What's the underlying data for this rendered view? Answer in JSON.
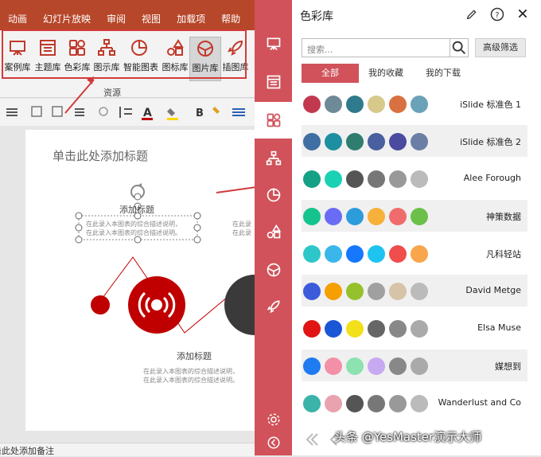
{
  "ribbon": {
    "tabs": [
      "动画",
      "幻灯片放映",
      "审阅",
      "视图",
      "加载项",
      "帮助",
      "O"
    ],
    "buttons": [
      "案例库",
      "主题库",
      "色彩库",
      "图示库",
      "智能图表",
      "图标库",
      "图片库",
      "插图库"
    ],
    "group_label": "资源"
  },
  "slide": {
    "title_placeholder": "单击此处添加标题",
    "node_title_1": "添加标题",
    "node_title_2": "添加标题",
    "desc_line_1": "在此录入本图表的综合描述说明，",
    "desc_line_2": "在此录入本图表的综合描述说明。",
    "desc_right_1": "在此录",
    "desc_right_2": "在此录"
  },
  "statusbar": {
    "left_text": "单击此处添加备注"
  },
  "panel": {
    "title": "色彩库",
    "search_placeholder": "搜索...",
    "advanced_filter": "高级筛选",
    "filter_tabs": [
      "全部",
      "我的收藏",
      "我的下载"
    ],
    "palettes": [
      {
        "name": "iSlide 标准色 1",
        "colors": [
          "#c2394f",
          "#6e8a96",
          "#2f7a8c",
          "#d6c98a",
          "#d9703f",
          "#6aa2b8"
        ]
      },
      {
        "name": "iSlide 标准色 2",
        "colors": [
          "#3f6fa3",
          "#1e8fa0",
          "#2e7d6e",
          "#4a5fa0",
          "#4a4aa0",
          "#6b7fa6"
        ]
      },
      {
        "name": "Alee Forough",
        "colors": [
          "#16a085",
          "#1bd1b4",
          "#555555",
          "#777777",
          "#999999",
          "#bbbbbb"
        ]
      },
      {
        "name": "神策数据",
        "colors": [
          "#14c38e",
          "#6a6cf6",
          "#2d9cdb",
          "#f7b03a",
          "#f06c6c",
          "#6cc04a"
        ]
      },
      {
        "name": "凡科轻站",
        "colors": [
          "#2ec7c9",
          "#3bb6e8",
          "#1677ff",
          "#1ec4f0",
          "#f04d4d",
          "#f8a54b"
        ]
      },
      {
        "name": "David Metge",
        "colors": [
          "#3b5bdb",
          "#f59f00",
          "#94c12c",
          "#a0a0a0",
          "#d6c3a8",
          "#bbbbbb"
        ]
      },
      {
        "name": "Elsa Muse",
        "colors": [
          "#e01414",
          "#1a56d6",
          "#f2e01a",
          "#666666",
          "#888888",
          "#aaaaaa"
        ]
      },
      {
        "name": "媒想到",
        "colors": [
          "#1e7bf0",
          "#f48fa8",
          "#8de2b0",
          "#c7a9f2",
          "#888888",
          "#aaaaaa"
        ]
      },
      {
        "name": "Wanderlust and Co",
        "colors": [
          "#3bb3a8",
          "#e8a3ae",
          "#555555",
          "#777777",
          "#999999",
          "#bbbbbb"
        ]
      }
    ]
  },
  "watermark": "头条 @YesMaster演示大师",
  "colors": {
    "accent_red": "#d1525a",
    "ribbon_red": "#b7472a",
    "slide_red": "#c00000"
  }
}
